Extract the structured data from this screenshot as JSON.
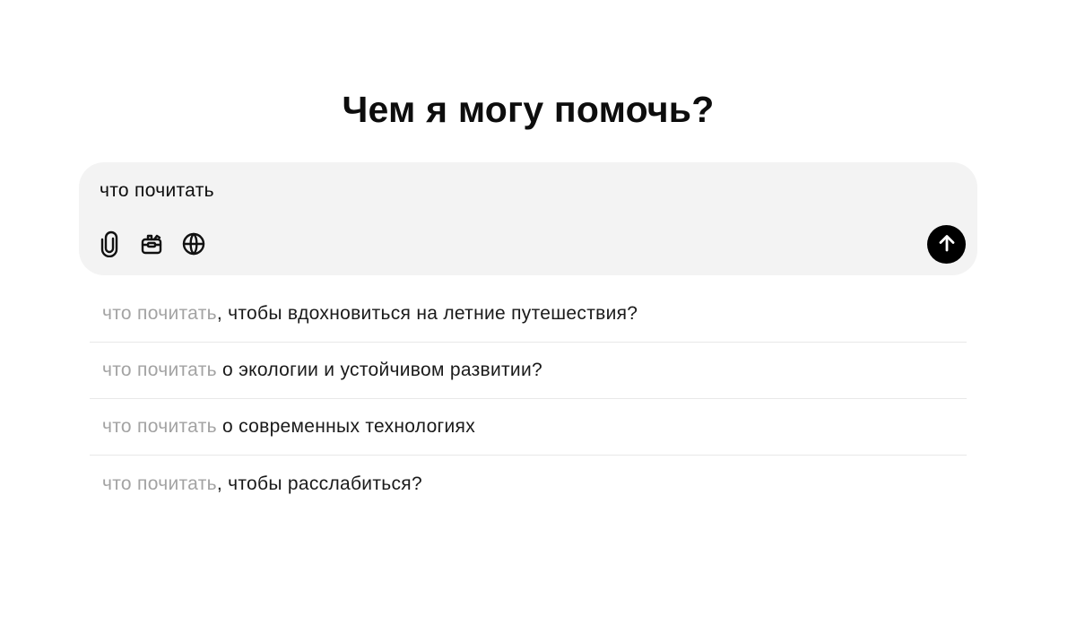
{
  "heading": "Чем я могу помочь?",
  "composer": {
    "value": "что почитать",
    "tools": [
      {
        "icon": "paperclip-icon",
        "label": "attach"
      },
      {
        "icon": "toolkit-icon",
        "label": "tools"
      },
      {
        "icon": "globe-icon",
        "label": "search"
      }
    ],
    "send_icon": "arrow-up-icon"
  },
  "suggestions": [
    {
      "prefix": "что почитать",
      "rest": ", чтобы вдохновиться на летние путешествия?"
    },
    {
      "prefix": "что почитать",
      "rest": " о экологии и устойчивом развитии?"
    },
    {
      "prefix": "что почитать",
      "rest": " о современных технологиях"
    },
    {
      "prefix": "что почитать",
      "rest": ", чтобы расслабиться?"
    }
  ],
  "colors": {
    "composer_bg": "#f3f3f3",
    "send_bg": "#000000",
    "prefix_text": "#a3a3a3",
    "divider": "#e8e8e8"
  }
}
